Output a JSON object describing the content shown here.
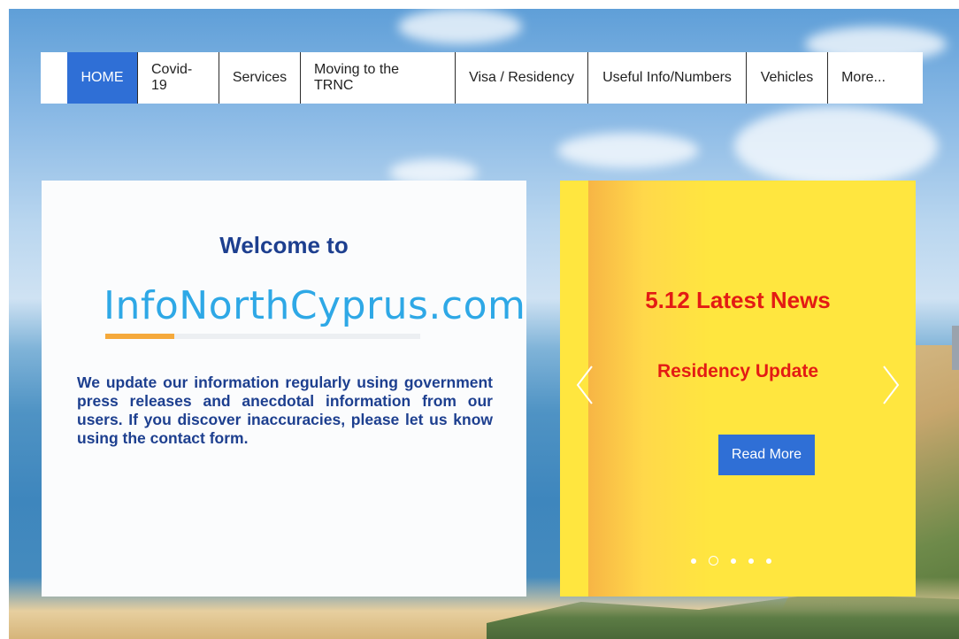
{
  "nav": {
    "items": [
      {
        "label": "HOME",
        "active": true
      },
      {
        "label": "Covid-19"
      },
      {
        "label": "Services"
      },
      {
        "label": "Moving to the TRNC"
      },
      {
        "label": "Visa / Residency"
      },
      {
        "label": "Useful Info/Numbers"
      },
      {
        "label": "Vehicles"
      },
      {
        "label": "More..."
      }
    ]
  },
  "welcome": {
    "heading": "Welcome to",
    "brand": "InfoNorthCyprus.com",
    "text": "We update our information regularly using government press releases and anecdotal information from our users. If you discover inaccuracies, please let us know using the contact form."
  },
  "news": {
    "title": "5.12 Latest News",
    "subtitle": "Residency Update",
    "button": "Read More",
    "slide_count": 5,
    "active_slide": 2
  },
  "colors": {
    "nav_active": "#2f6fd6",
    "welcome_text": "#1d3f8f",
    "brand": "#2ea8e6",
    "news_bg": "#ffe63f",
    "news_text": "#e31b14"
  }
}
